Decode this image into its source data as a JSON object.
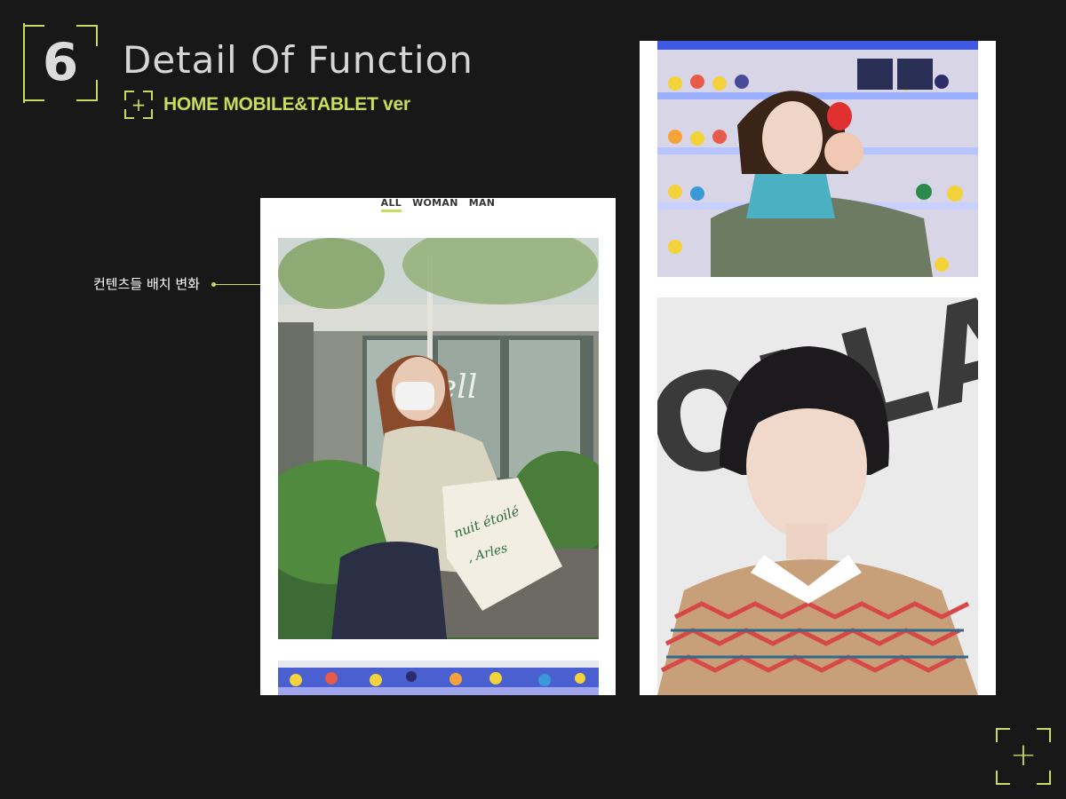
{
  "section": {
    "number": "6",
    "title": "Detail Of Function",
    "subtitle": "HOME MOBILE&TABLET ver",
    "plus_glyph": "+"
  },
  "annotation": {
    "label": "컨텐츠들 배치 변화"
  },
  "mobile_preview": {
    "tabs": [
      {
        "label": "ALL",
        "active": true
      },
      {
        "label": "WOMAN",
        "active": false
      },
      {
        "label": "MAN",
        "active": false
      }
    ],
    "photos": [
      {
        "icon": "photo-woman-masked-tote-bag",
        "bag_text_1": "nuit étoilé",
        "bag_text_2": ", Arles",
        "sign_text": "ell"
      },
      {
        "icon": "photo-duck-shelf-partial"
      }
    ]
  },
  "tablet_preview": {
    "photos": [
      {
        "icon": "photo-woman-holding-duck"
      },
      {
        "icon": "photo-man-patterned-sweater",
        "wall_text": "OLLAT"
      }
    ]
  },
  "colors": {
    "background": "#181818",
    "accent": "#c9dc5b",
    "title": "#d6d6d6",
    "panel": "#ffffff"
  },
  "corner_button": {
    "glyph": "+"
  }
}
